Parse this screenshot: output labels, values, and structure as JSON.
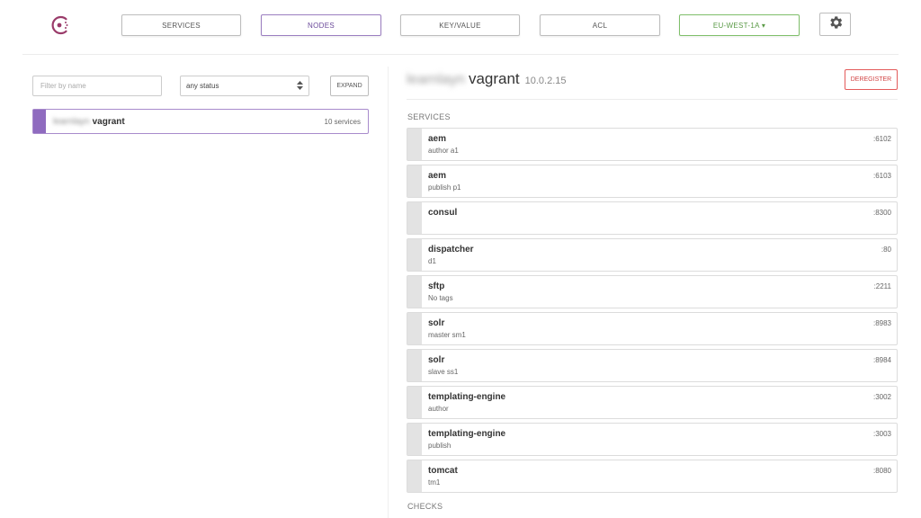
{
  "nav": {
    "services": "SERVICES",
    "nodes": "NODES",
    "key_value": "KEY/VALUE",
    "acl": "ACL",
    "datacenter": "EU-WEST-1A ▾"
  },
  "filters": {
    "name_placeholder": "Filter by name",
    "status_value": "any status",
    "expand_label": "EXPAND"
  },
  "nodes": [
    {
      "redacted_prefix": "learnlayn",
      "name": "vagrant",
      "services_count": "10 services"
    }
  ],
  "detail": {
    "redacted_prefix": "learnlayn",
    "name": "vagrant",
    "address": "10.0.2.15",
    "deregister_label": "DEREGISTER",
    "services_heading": "SERVICES",
    "checks_heading": "CHECKS",
    "services": [
      {
        "name": "aem",
        "tags": "author a1",
        "port": ":6102"
      },
      {
        "name": "aem",
        "tags": "publish p1",
        "port": ":6103"
      },
      {
        "name": "consul",
        "tags": "",
        "port": ":8300"
      },
      {
        "name": "dispatcher",
        "tags": "d1",
        "port": ":80"
      },
      {
        "name": "sftp",
        "tags": "No tags",
        "port": ":2211"
      },
      {
        "name": "solr",
        "tags": "master sm1",
        "port": ":8983"
      },
      {
        "name": "solr",
        "tags": "slave ss1",
        "port": ":8984"
      },
      {
        "name": "templating-engine",
        "tags": "author",
        "port": ":3002"
      },
      {
        "name": "templating-engine",
        "tags": "publish",
        "port": ":3003"
      },
      {
        "name": "tomcat",
        "tags": "tm1",
        "port": ":8080"
      }
    ]
  },
  "colors": {
    "accent_purple": "#8f6bbf",
    "datacenter_green": "#7fbf6a",
    "danger_red": "#d24545"
  },
  "icons": {
    "logo": "consul-logo-icon",
    "settings": "gear-icon",
    "select_arrow": "updown-arrows-icon"
  }
}
